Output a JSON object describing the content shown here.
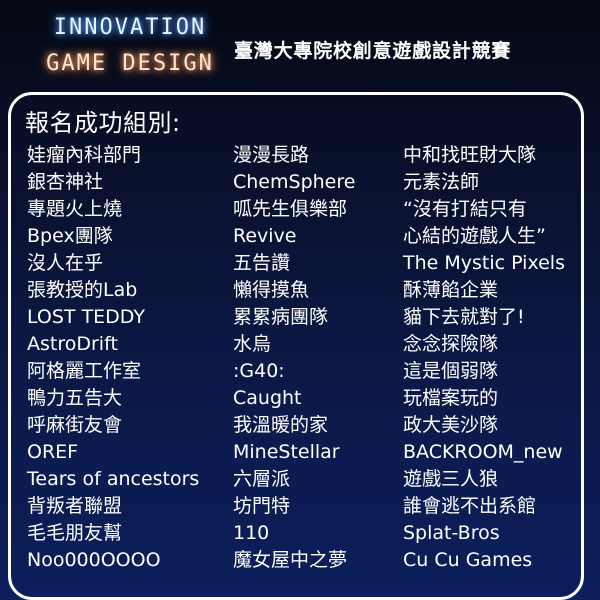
{
  "logo": {
    "line1": "INNOVATION",
    "line2": "GAME DESIGN"
  },
  "event_title": "臺灣大專院校創意遊戲設計競賽",
  "panel": {
    "heading": "報名成功組別:"
  },
  "teams": {
    "column1": [
      "娃瘤內科部門",
      "銀杏神社",
      "專題火上燒",
      "Bpex團隊",
      "沒人在乎",
      "張教授的Lab",
      "LOST TEDDY",
      "AstroDrift",
      "阿格麗工作室",
      "鴨力五告大",
      "呼麻街友會",
      "OREF",
      "Tears of ancestors",
      "背叛者聯盟",
      "毛毛朋友幫",
      "Noo000OOOO"
    ],
    "column2": [
      "漫漫長路",
      "ChemSphere",
      "呱先生俱樂部",
      "Revive",
      "五告讚",
      "懶得摸魚",
      "累累病團隊",
      "水烏",
      ":G40:",
      "Caught",
      "我溫暖的家",
      "MineStellar",
      "六層派",
      "坊門特",
      "110",
      "魔女屋中之夢"
    ],
    "column3": [
      "中和找旺財大隊",
      "元素法師",
      "“沒有打結只有",
      "心結的遊戲人生”",
      "The Mystic Pixels",
      "酥薄餡企業",
      "貓下去就對了!",
      "念念探險隊",
      "這是個弱隊",
      "玩檔案玩的",
      "政大美沙隊",
      "BACKROOM_new",
      "遊戲三人狼",
      "誰會逃不出系館",
      "Splat-Bros",
      "Cu Cu Games"
    ]
  },
  "colors": {
    "background_top": "#050914",
    "background_bottom": "#0c1f5c",
    "logo_line1_glow": "#6fb0ff",
    "logo_line2_glow": "#ff7a2f",
    "panel_border": "#ffffff",
    "text": "#ffffff"
  }
}
